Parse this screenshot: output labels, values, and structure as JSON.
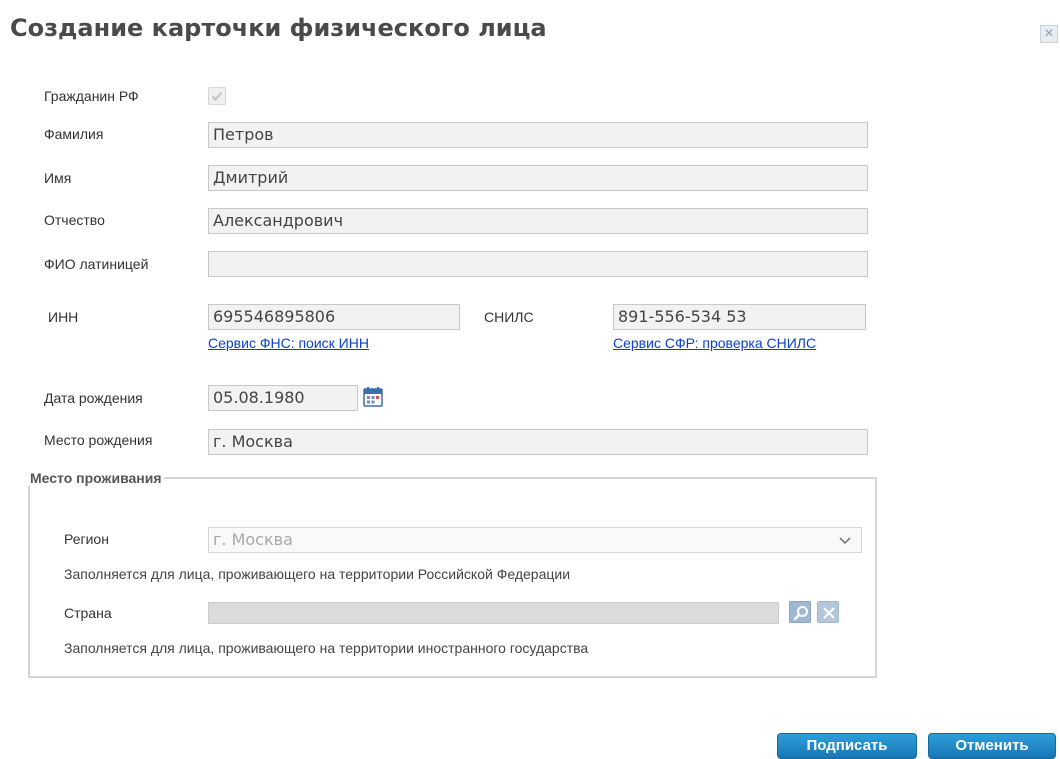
{
  "dialog": {
    "title": "Создание карточки физического лица"
  },
  "form": {
    "citizen_label": "Гражданин РФ",
    "citizen_checked": true,
    "lastname": {
      "label": "Фамилия",
      "value": "Петров"
    },
    "firstname": {
      "label": "Имя",
      "value": "Дмитрий"
    },
    "patronymic": {
      "label": "Отчество",
      "value": "Александрович"
    },
    "latin_name": {
      "label": "ФИО латиницей",
      "value": ""
    },
    "inn": {
      "label": "ИНН",
      "value": "695546895806",
      "link": "Сервис ФНС: поиск ИНН"
    },
    "snils": {
      "label": "СНИЛС",
      "value": "891-556-534 53",
      "link": "Сервис СФР: проверка СНИЛС"
    },
    "birth_date": {
      "label": "Дата рождения",
      "value": "05.08.1980"
    },
    "birth_place": {
      "label": "Место рождения",
      "value": "г. Москва"
    }
  },
  "residence": {
    "legend": "Место проживания",
    "region": {
      "label": "Регион",
      "value": "г. Москва",
      "hint": "Заполняется для лица, проживающего на территории Российской Федерации"
    },
    "country": {
      "label": "Страна",
      "value": "",
      "hint": "Заполняется для лица, проживающего на территории иностранного государства"
    }
  },
  "actions": {
    "sign_label": "Подписать",
    "cancel_label": "Отменить"
  },
  "colors": {
    "accent": "#1f88c8",
    "link": "#0b3fd6",
    "field_bg": "#f2f2f2"
  },
  "icons": {
    "close": "close-icon",
    "calendar": "calendar-icon",
    "search": "search-icon",
    "clear": "clear-icon",
    "dropdown": "chevron-down-icon",
    "check": "checkmark-icon"
  }
}
